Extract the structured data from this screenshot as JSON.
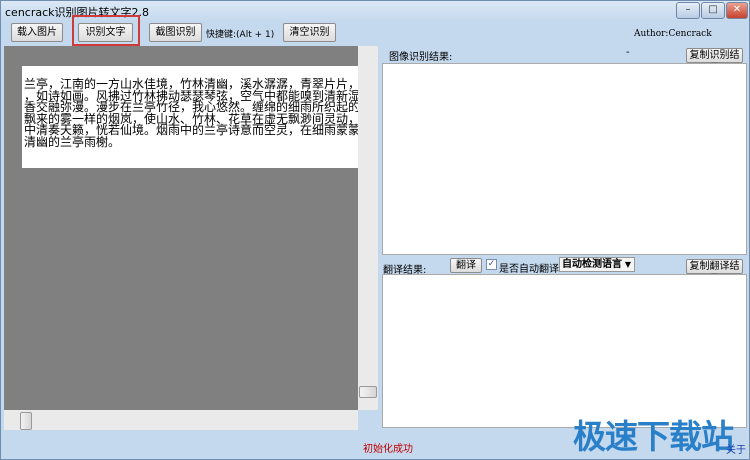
{
  "window": {
    "title": "cencrack识别图片转文字2.8",
    "minimize": "–",
    "maximize": "□",
    "close": "✕"
  },
  "toolbar": {
    "load": "载入图片",
    "recognize": "识别文字",
    "screenshot": "截图识别",
    "shortcut": "快捷键:(Alt + 1)",
    "clear": "清空识别",
    "author": "Author:Cencrack"
  },
  "image_text": [
    "兰亭，江南的一方山水佳境，竹林清幽，溪水潺潺，青翠片片，翠",
    "，如诗如画。风拂过竹林拂动瑟瑟琴弦，空气中都能嗅到清新湿润",
    "香交融弥漫。漫步在兰亭竹径，我心悠然。缠绵的细雨所织起的",
    "飘来的雾一样的烟岚，使山水、竹林、花草在虚无飘渺间灵动，",
    "中清奏天籁，恍若仙境。烟雨中的兰亭诗意而空灵，在细雨蒙蒙中",
    "清幽的兰亭雨榭。"
  ],
  "ocr": {
    "label": "图像识别结果:",
    "dash": "-",
    "copy": "复制识别结果",
    "value": ""
  },
  "translate": {
    "label": "翻译结果:",
    "button": "翻译",
    "auto_label": "是否自动翻译",
    "auto_checked": true,
    "language": "自动检测语言",
    "copy": "复制翻译结果",
    "value": ""
  },
  "status": {
    "text": "初始化成功",
    "about": "关于"
  },
  "watermark": "极速下载站",
  "colors": {
    "highlight": "#d23a3a",
    "status": "#c00000",
    "watermark": "#2a7fc9"
  }
}
